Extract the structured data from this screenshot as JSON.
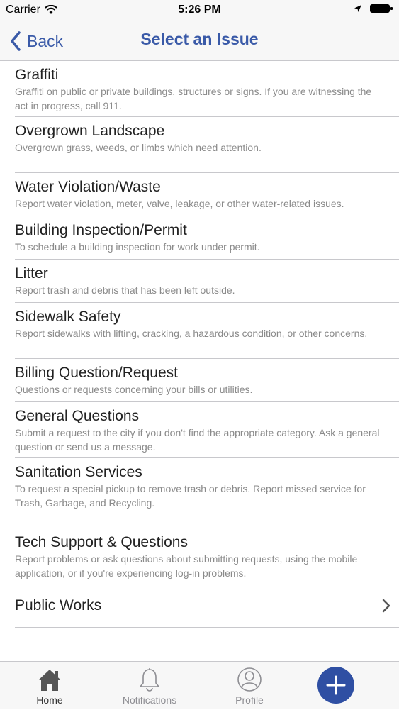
{
  "status_bar": {
    "carrier": "Carrier",
    "time": "5:26 PM"
  },
  "nav": {
    "back_label": "Back",
    "title": "Select an Issue"
  },
  "issues": [
    {
      "title": "Graffiti",
      "desc": "Graffiti on public or private buildings, structures or signs.  If you are witnessing the act in progress, call 911."
    },
    {
      "title": "Overgrown Landscape",
      "desc": "Overgrown grass, weeds, or limbs which need attention."
    },
    {
      "title": "Water Violation/Waste",
      "desc": "Report water violation, meter, valve, leakage, or other water-related issues."
    },
    {
      "title": "Building Inspection/Permit",
      "desc": "To schedule a building inspection for work under permit."
    },
    {
      "title": "Litter",
      "desc": "Report trash and debris that has been left outside."
    },
    {
      "title": "Sidewalk Safety",
      "desc": "Report sidewalks with lifting, cracking, a hazardous condition, or other concerns."
    },
    {
      "title": "Billing Question/Request",
      "desc": "Questions or requests concerning your bills or utilities."
    },
    {
      "title": "General Questions",
      "desc": "Submit a request to the city if you don't find the appropriate category. Ask a general question or send us a message."
    },
    {
      "title": "Sanitation Services",
      "desc": "To request a special pickup to remove trash or debris. Report missed service for Trash, Garbage, and Recycling."
    },
    {
      "title": "Tech Support & Questions",
      "desc": "Report problems or ask questions about submitting requests, using the mobile application, or if you're experiencing log-in problems."
    },
    {
      "title": "Public Works",
      "desc": ""
    }
  ],
  "tabs": {
    "home": "Home",
    "notifications": "Notifications",
    "profile": "Profile"
  },
  "colors": {
    "accent": "#3a5aa8",
    "fab": "#2f4fa3"
  }
}
